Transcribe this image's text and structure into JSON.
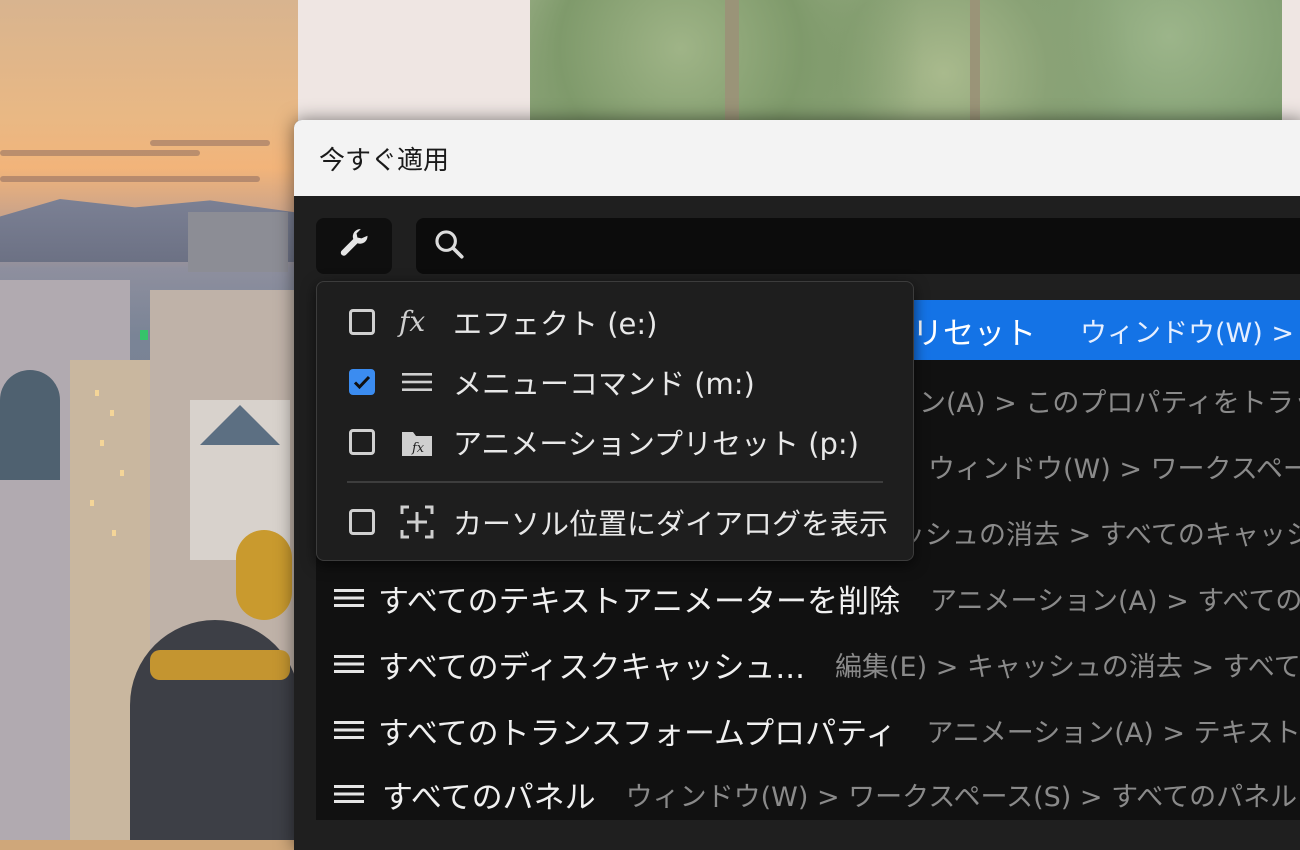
{
  "dialog": {
    "title": "今すぐ適用",
    "search_placeholder": ""
  },
  "filter_menu": {
    "items": [
      {
        "label": "エフェクト (e:)",
        "checked": false,
        "icon": "fx-icon"
      },
      {
        "label": "メニューコマンド (m:)",
        "checked": true,
        "icon": "menu-lines-icon"
      },
      {
        "label": "アニメーションプリセット (p:)",
        "checked": false,
        "icon": "preset-icon"
      },
      {
        "label": "カーソル位置にダイアログを表示",
        "checked": false,
        "icon": "cursor-position-icon"
      }
    ]
  },
  "results": {
    "selected": {
      "name": "リセット",
      "path": "ウィンドウ(W) > ワ"
    },
    "rows": [
      {
        "name": "",
        "path": "ョン(A) > このプロパティをトラック"
      },
      {
        "name": "",
        "path": "ウィンドウ(W) > ワークスペース"
      },
      {
        "name": "",
        "path": "ッシュの消去 > すべてのキャッシュ"
      },
      {
        "name": "すべてのテキストアニメーターを削除",
        "path": "アニメーション(A) > すべてのテ"
      },
      {
        "name": "すべてのディスクキャッシュ...",
        "path": "編集(E) > キャッシュの消去 > すべての"
      },
      {
        "name": "すべてのトランスフォームプロパティ",
        "path": "アニメーション(A) > テキストのア"
      },
      {
        "name": "すべてのパネル",
        "path": "ウィンドウ(W) > ワークスペース(S) > すべてのパネル"
      }
    ]
  },
  "colors": {
    "accent": "#1473e6",
    "checkbox_on": "#3b8cf0",
    "dialog_bg": "#1f1f1f",
    "titlebar_bg": "#f3f3f3"
  }
}
